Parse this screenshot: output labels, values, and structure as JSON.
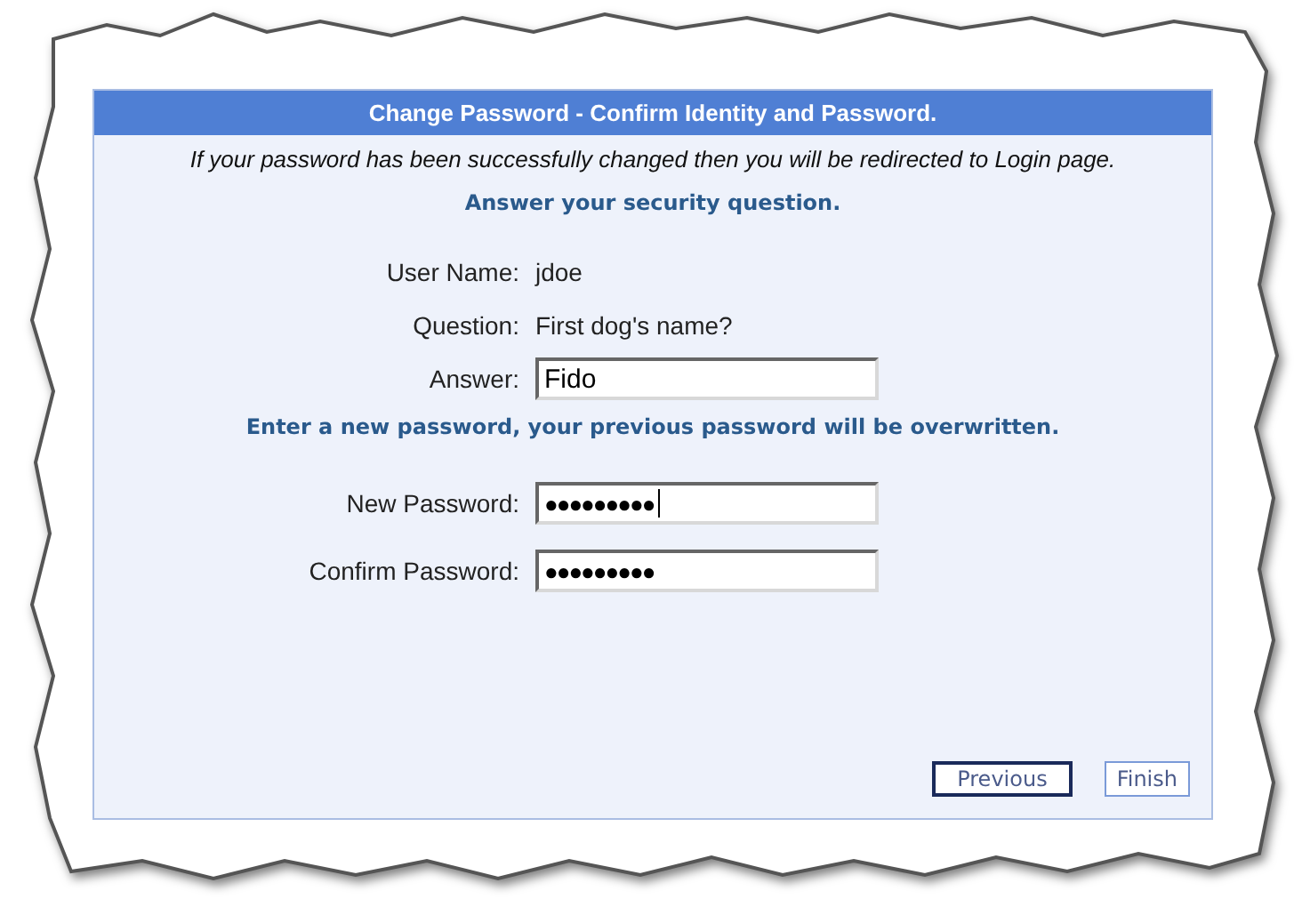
{
  "panel": {
    "title": "Change Password - Confirm Identity and Password.",
    "note": "If your password has been successfully changed then you will be redirected to Login page."
  },
  "sections": [
    {
      "heading": "Answer your security question.",
      "rows": [
        {
          "kind": "text",
          "label": "User Name:",
          "value": "jdoe"
        },
        {
          "kind": "text",
          "label": "Question:",
          "value": "First dog's name?"
        },
        {
          "kind": "field",
          "label": "Answer:",
          "value": "Fido",
          "focused": false
        }
      ]
    },
    {
      "heading": "Enter a new password, your previous password will be overwritten.",
      "rows": [
        {
          "kind": "field",
          "label": "New Password:",
          "value": "●●●●●●●●●",
          "focused": true
        },
        {
          "kind": "field",
          "label": "Confirm Password:",
          "value": "●●●●●●●●●",
          "focused": false
        }
      ]
    }
  ],
  "buttons": [
    {
      "label": "Previous",
      "default": true
    },
    {
      "label": "Finish",
      "default": false
    }
  ]
}
